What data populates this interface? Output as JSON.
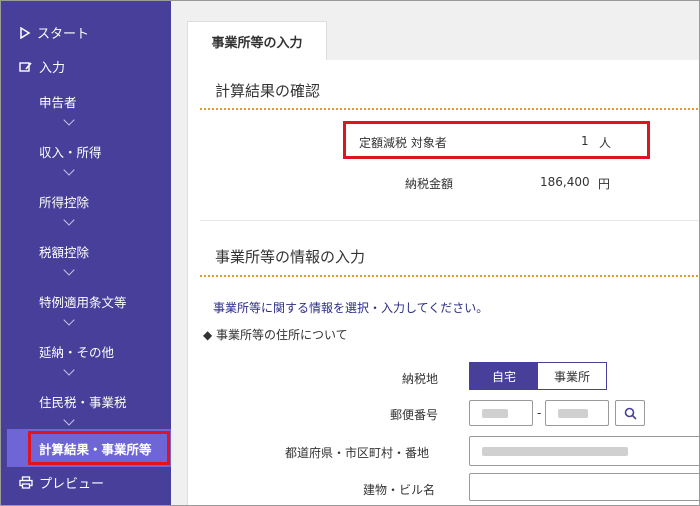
{
  "sidebar": {
    "start": "スタート",
    "input": "入力",
    "items": [
      "申告者",
      "収入・所得",
      "所得控除",
      "税額控除",
      "特例適用条文等",
      "延納・その他",
      "住民税・事業税"
    ],
    "active": "計算結果・事業所等",
    "preview": "プレビュー"
  },
  "tab": "事業所等の入力",
  "result": {
    "title": "計算結果の確認",
    "rows": [
      {
        "label": "定額減税 対象者",
        "value": "1",
        "unit": "人"
      },
      {
        "label": "納税金額",
        "value": "186,400",
        "unit": "円"
      }
    ]
  },
  "info": {
    "title": "事業所等の情報の入力",
    "intro": "事業所等に関する情報を選択・入力してください。",
    "bullet": "◆ 事業所等の住所について",
    "tax_place_label": "納税地",
    "tax_place_options": [
      "自宅",
      "事業所"
    ],
    "tax_place_selected": "自宅",
    "postal_label": "郵便番号",
    "postal_dash": "-",
    "address_label": "都道府県・市区町村・番地",
    "building_label": "建物・ビル名"
  },
  "colors": {
    "sidebar": "#473f99",
    "active": "#6e65d7",
    "highlight": "#e0141e",
    "dotline": "#e59c22"
  }
}
